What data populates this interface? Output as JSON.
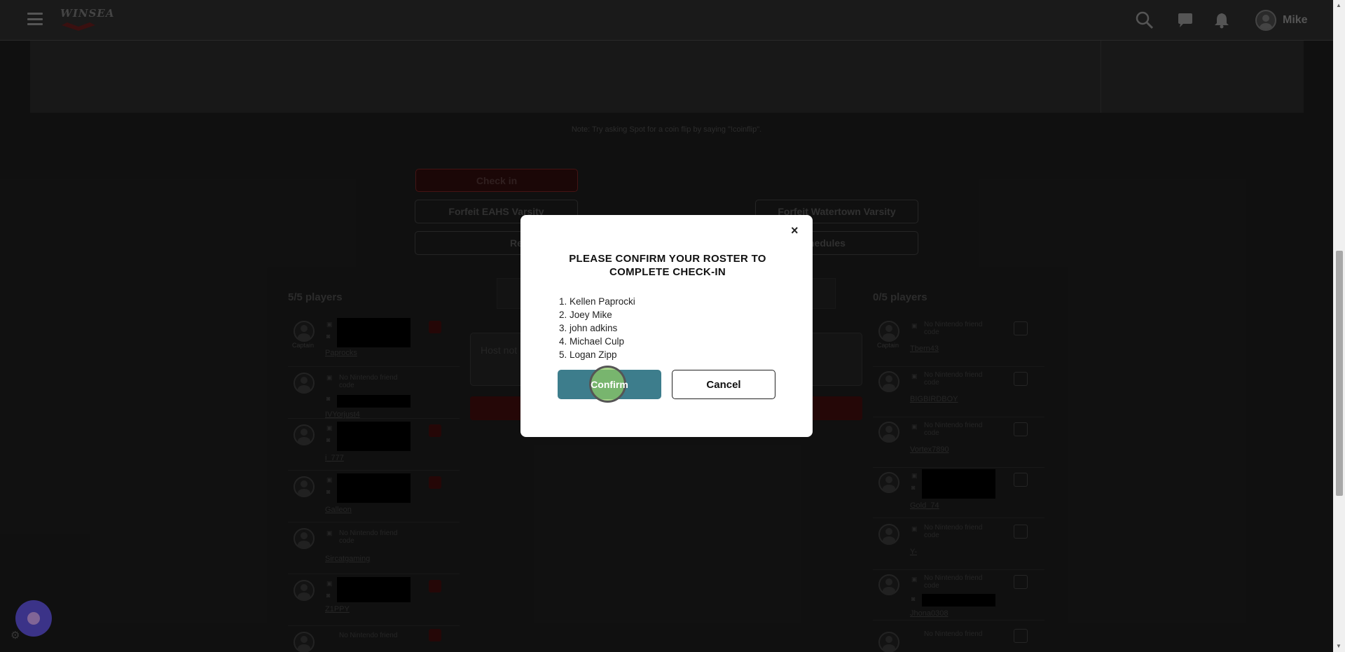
{
  "header": {
    "logo_text": "WINSEA",
    "username": "Mike"
  },
  "note": "Note: Try asking Spot for a coin flip by saying \"!coinflip\".",
  "actions": {
    "check_in": "Check in",
    "forfeit_left": "Forfeit EAHS Varsity",
    "forfeit_right": "Forfeit Watertown Varsity",
    "left_bottom_partial": "Re",
    "right_bottom_partial": "hedules"
  },
  "left_team": {
    "count": "5/5 players",
    "players": [
      {
        "name": "Paprocks",
        "captain": "Captain",
        "code": ""
      },
      {
        "name": "IVYorjust4",
        "captain": "",
        "code": "No Nintendo friend code"
      },
      {
        "name": "i_777",
        "captain": "",
        "code": ""
      },
      {
        "name": "Galleon",
        "captain": "",
        "code": ""
      },
      {
        "name": "Sircatgaming",
        "captain": "",
        "code": "No Nintendo friend code"
      },
      {
        "name": "Z1PPY",
        "captain": "",
        "code": ""
      },
      {
        "name": "",
        "captain": "",
        "code": "No Nintendo friend"
      }
    ]
  },
  "right_team": {
    "count": "0/5 players",
    "players": [
      {
        "name": "Tbern43",
        "captain": "Captain",
        "code": "No Nintendo friend code"
      },
      {
        "name": "BIGBIRDBOY",
        "captain": "",
        "code": "No Nintendo friend code"
      },
      {
        "name": "Vortex7890",
        "captain": "",
        "code": "No Nintendo friend code"
      },
      {
        "name": "Gold_74",
        "captain": "",
        "code": ""
      },
      {
        "name": "Y-",
        "captain": "",
        "code": "No Nintendo friend code"
      },
      {
        "name": "Jhona0308",
        "captain": "",
        "code": "No Nintendo friend code"
      },
      {
        "name": "",
        "captain": "",
        "code": "No Nintendo friend"
      }
    ]
  },
  "host_notes_placeholder": "Host not",
  "modal": {
    "title": "PLEASE CONFIRM YOUR ROSTER TO COMPLETE CHECK-IN",
    "close": "×",
    "roster": [
      "1. Kellen Paprocki",
      "2. Joey Mike",
      "3. john adkins",
      "4. Michael Culp",
      "5. Logan Zipp"
    ],
    "confirm_label": "Confirm",
    "cancel_label": "Cancel"
  },
  "colors": {
    "confirm": "#3d7d8c",
    "checkin_border": "#6a1f1f",
    "chat_fab": "#5b4fd1"
  }
}
